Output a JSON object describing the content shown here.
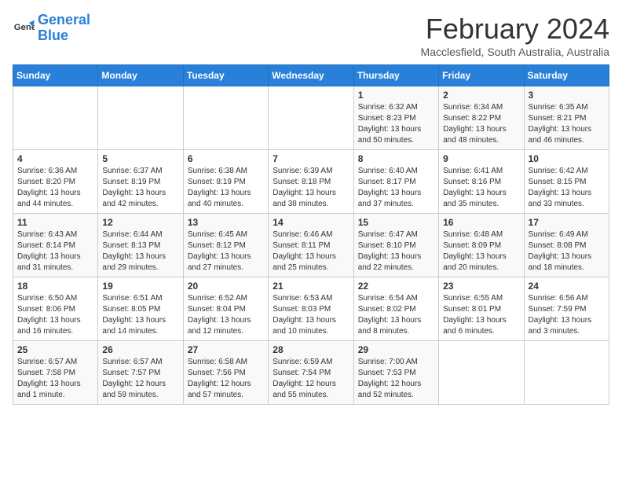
{
  "header": {
    "logo_general": "General",
    "logo_blue": "Blue",
    "month_year": "February 2024",
    "location": "Macclesfield, South Australia, Australia"
  },
  "days_of_week": [
    "Sunday",
    "Monday",
    "Tuesday",
    "Wednesday",
    "Thursday",
    "Friday",
    "Saturday"
  ],
  "weeks": [
    [
      {
        "num": "",
        "info": ""
      },
      {
        "num": "",
        "info": ""
      },
      {
        "num": "",
        "info": ""
      },
      {
        "num": "",
        "info": ""
      },
      {
        "num": "1",
        "info": "Sunrise: 6:32 AM\nSunset: 8:23 PM\nDaylight: 13 hours\nand 50 minutes."
      },
      {
        "num": "2",
        "info": "Sunrise: 6:34 AM\nSunset: 8:22 PM\nDaylight: 13 hours\nand 48 minutes."
      },
      {
        "num": "3",
        "info": "Sunrise: 6:35 AM\nSunset: 8:21 PM\nDaylight: 13 hours\nand 46 minutes."
      }
    ],
    [
      {
        "num": "4",
        "info": "Sunrise: 6:36 AM\nSunset: 8:20 PM\nDaylight: 13 hours\nand 44 minutes."
      },
      {
        "num": "5",
        "info": "Sunrise: 6:37 AM\nSunset: 8:19 PM\nDaylight: 13 hours\nand 42 minutes."
      },
      {
        "num": "6",
        "info": "Sunrise: 6:38 AM\nSunset: 8:19 PM\nDaylight: 13 hours\nand 40 minutes."
      },
      {
        "num": "7",
        "info": "Sunrise: 6:39 AM\nSunset: 8:18 PM\nDaylight: 13 hours\nand 38 minutes."
      },
      {
        "num": "8",
        "info": "Sunrise: 6:40 AM\nSunset: 8:17 PM\nDaylight: 13 hours\nand 37 minutes."
      },
      {
        "num": "9",
        "info": "Sunrise: 6:41 AM\nSunset: 8:16 PM\nDaylight: 13 hours\nand 35 minutes."
      },
      {
        "num": "10",
        "info": "Sunrise: 6:42 AM\nSunset: 8:15 PM\nDaylight: 13 hours\nand 33 minutes."
      }
    ],
    [
      {
        "num": "11",
        "info": "Sunrise: 6:43 AM\nSunset: 8:14 PM\nDaylight: 13 hours\nand 31 minutes."
      },
      {
        "num": "12",
        "info": "Sunrise: 6:44 AM\nSunset: 8:13 PM\nDaylight: 13 hours\nand 29 minutes."
      },
      {
        "num": "13",
        "info": "Sunrise: 6:45 AM\nSunset: 8:12 PM\nDaylight: 13 hours\nand 27 minutes."
      },
      {
        "num": "14",
        "info": "Sunrise: 6:46 AM\nSunset: 8:11 PM\nDaylight: 13 hours\nand 25 minutes."
      },
      {
        "num": "15",
        "info": "Sunrise: 6:47 AM\nSunset: 8:10 PM\nDaylight: 13 hours\nand 22 minutes."
      },
      {
        "num": "16",
        "info": "Sunrise: 6:48 AM\nSunset: 8:09 PM\nDaylight: 13 hours\nand 20 minutes."
      },
      {
        "num": "17",
        "info": "Sunrise: 6:49 AM\nSunset: 8:08 PM\nDaylight: 13 hours\nand 18 minutes."
      }
    ],
    [
      {
        "num": "18",
        "info": "Sunrise: 6:50 AM\nSunset: 8:06 PM\nDaylight: 13 hours\nand 16 minutes."
      },
      {
        "num": "19",
        "info": "Sunrise: 6:51 AM\nSunset: 8:05 PM\nDaylight: 13 hours\nand 14 minutes."
      },
      {
        "num": "20",
        "info": "Sunrise: 6:52 AM\nSunset: 8:04 PM\nDaylight: 13 hours\nand 12 minutes."
      },
      {
        "num": "21",
        "info": "Sunrise: 6:53 AM\nSunset: 8:03 PM\nDaylight: 13 hours\nand 10 minutes."
      },
      {
        "num": "22",
        "info": "Sunrise: 6:54 AM\nSunset: 8:02 PM\nDaylight: 13 hours\nand 8 minutes."
      },
      {
        "num": "23",
        "info": "Sunrise: 6:55 AM\nSunset: 8:01 PM\nDaylight: 13 hours\nand 6 minutes."
      },
      {
        "num": "24",
        "info": "Sunrise: 6:56 AM\nSunset: 7:59 PM\nDaylight: 13 hours\nand 3 minutes."
      }
    ],
    [
      {
        "num": "25",
        "info": "Sunrise: 6:57 AM\nSunset: 7:58 PM\nDaylight: 13 hours\nand 1 minute."
      },
      {
        "num": "26",
        "info": "Sunrise: 6:57 AM\nSunset: 7:57 PM\nDaylight: 12 hours\nand 59 minutes."
      },
      {
        "num": "27",
        "info": "Sunrise: 6:58 AM\nSunset: 7:56 PM\nDaylight: 12 hours\nand 57 minutes."
      },
      {
        "num": "28",
        "info": "Sunrise: 6:59 AM\nSunset: 7:54 PM\nDaylight: 12 hours\nand 55 minutes."
      },
      {
        "num": "29",
        "info": "Sunrise: 7:00 AM\nSunset: 7:53 PM\nDaylight: 12 hours\nand 52 minutes."
      },
      {
        "num": "",
        "info": ""
      },
      {
        "num": "",
        "info": ""
      }
    ]
  ]
}
